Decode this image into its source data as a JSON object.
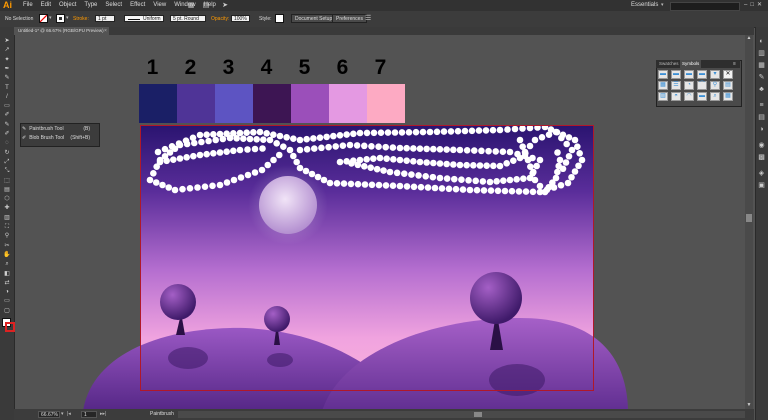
{
  "app": {
    "logo": "Ai",
    "menus": [
      "File",
      "Edit",
      "Object",
      "Type",
      "Select",
      "Effect",
      "View",
      "Window",
      "Help"
    ],
    "workspace": "Essentials",
    "workspace_arrow": "▾",
    "window_controls": "–□✕"
  },
  "control_bar": {
    "selection": "No Selection",
    "stroke_label": "Stroke:",
    "stroke_value": "1 pt",
    "profile_value": "Uniform",
    "brush_value": "5 pt. Round",
    "opacity_label": "Opacity:",
    "opacity_value": "100%",
    "style_label": "Style:",
    "document_setup": "Document Setup",
    "preferences": "Preferences",
    "accent_color": "#ff9a00"
  },
  "document_tab": {
    "title": "Untitled-1* @ 66.67% (RGB/GPU Preview)",
    "close": "×"
  },
  "tool_flyout": {
    "items": [
      {
        "label": "Paintbrush Tool",
        "shortcut": "(B)"
      },
      {
        "label": "Blob Brush Tool",
        "shortcut": "(Shift+B)"
      }
    ]
  },
  "panel": {
    "tabs": [
      "Swatches",
      "Symbols"
    ],
    "menu_icon": "≡",
    "close_icon": "✕"
  },
  "swatches": {
    "numbers": [
      "1",
      "2",
      "3",
      "4",
      "5",
      "6",
      "7"
    ],
    "colors": [
      "#1a1f66",
      "#4f3497",
      "#5d54c2",
      "#3d1553",
      "#9b4fba",
      "#e499e2",
      "#fdaac3"
    ]
  },
  "status_bar": {
    "zoom": "66.67%",
    "page": "1",
    "tool_name": "Paintbrush"
  }
}
